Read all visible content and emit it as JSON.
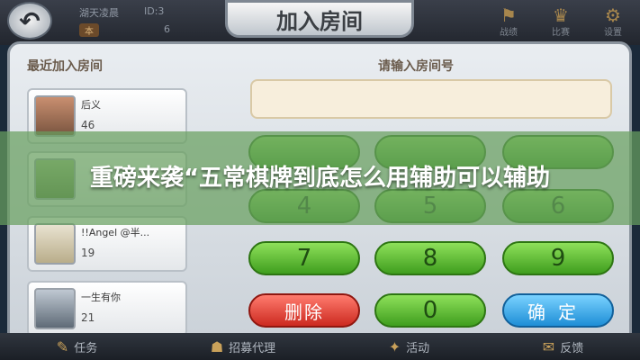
{
  "header": {
    "back_icon": "back-arrow-icon",
    "player_name": "湖天凌晨",
    "player_id": "ID:3",
    "player_badge": "本",
    "player_count": "6",
    "top_icons": [
      {
        "icon": "flag-icon",
        "label": "战绩"
      },
      {
        "icon": "trophy-icon",
        "label": "比赛"
      },
      {
        "icon": "gear-icon",
        "label": "设置"
      }
    ]
  },
  "dialog": {
    "title": "加入房间",
    "recent_heading": "最近加入房间",
    "input_heading": "请输入房间号",
    "room_input_value": ""
  },
  "recent_rooms": [
    {
      "name": "后义",
      "number": "46"
    },
    {
      "name": "",
      "number": ""
    },
    {
      "name": "!!Angel @半...",
      "number": "19"
    },
    {
      "name": "一生有你",
      "number": "21"
    }
  ],
  "keypad": {
    "row2": [
      "4",
      "5",
      "6"
    ],
    "row3": [
      "7",
      "8",
      "9"
    ],
    "delete_label": "删除",
    "zero_label": "0",
    "confirm_label": "确定"
  },
  "banner": {
    "text": "重磅来袭“五常棋牌到底怎么用辅助可以辅助"
  },
  "bottom_nav": [
    {
      "icon": "task-icon",
      "label": "任务"
    },
    {
      "icon": "recruit-icon",
      "label": "招募代理"
    },
    {
      "icon": "gift-icon",
      "label": "活动"
    },
    {
      "icon": "feedback-icon",
      "label": "反馈"
    }
  ],
  "colors": {
    "green_key": "#5cc234",
    "red_key": "#e0403a",
    "blue_key": "#2aa0e8",
    "banner": "#68a060"
  }
}
